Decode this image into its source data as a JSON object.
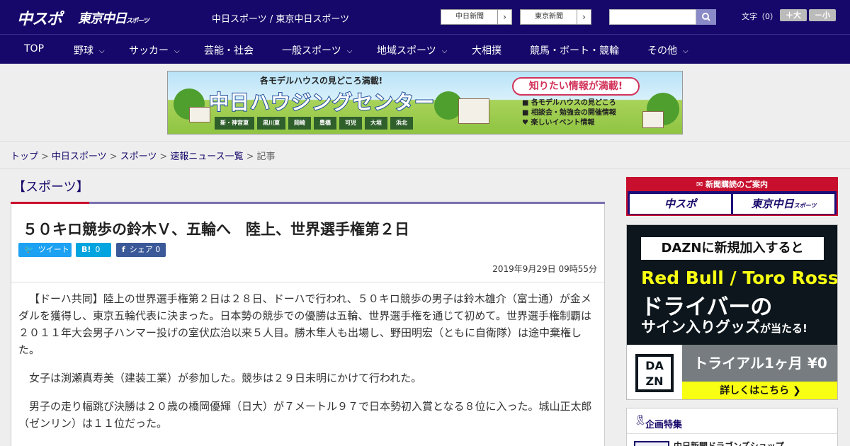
{
  "header": {
    "logo_main": "中スポ",
    "logo_tokyo": "東京中日",
    "logo_tokyo_sub": "スポーツ",
    "site_title": "中日スポーツ / 東京中日スポーツ",
    "links": [
      {
        "label": "中日新聞",
        "arrow": "›"
      },
      {
        "label": "東京新聞",
        "arrow": "›"
      }
    ],
    "search": {
      "placeholder": "",
      "icon": "search-icon"
    },
    "font_size": {
      "label": "文字（0）",
      "increase": "＋大",
      "decrease": "－小"
    }
  },
  "nav": {
    "items": [
      {
        "label": "TOP",
        "has_dropdown": false
      },
      {
        "label": "野球",
        "has_dropdown": true
      },
      {
        "label": "サッカー",
        "has_dropdown": true
      },
      {
        "label": "芸能・社会",
        "has_dropdown": false
      },
      {
        "label": "一般スポーツ",
        "has_dropdown": true
      },
      {
        "label": "地域スポーツ",
        "has_dropdown": true
      },
      {
        "label": "大相撲",
        "has_dropdown": false
      },
      {
        "label": "競馬・ボート・競輪",
        "has_dropdown": false
      },
      {
        "label": "その他",
        "has_dropdown": true
      }
    ],
    "chevron": "⌵"
  },
  "banner": {
    "top_text": "各モデルハウスの見どころ満載!",
    "main_text": "中日ハウジングセンター",
    "bubble": "知りたい情報が満載!",
    "list": [
      "各モデルハウスの見どころ",
      "相談会・勉強会の開催情報",
      "楽しいイベント情報"
    ],
    "locations": [
      "新・神宮東",
      "黒川東",
      "岡崎",
      "豊橋",
      "可児",
      "大垣",
      "浜北"
    ]
  },
  "breadcrumb": {
    "items": [
      {
        "label": "トップ",
        "link": true
      },
      {
        "label": "中日スポーツ",
        "link": true
      },
      {
        "label": "スポーツ",
        "link": true
      },
      {
        "label": "速報ニュース一覧",
        "link": true
      },
      {
        "label": "記事",
        "link": false
      }
    ],
    "separator": ">"
  },
  "section": {
    "title": "【スポーツ】"
  },
  "article": {
    "title": "５０キロ競歩の鈴木Ｖ、五輪へ　陸上、世界選手権第２日",
    "share": [
      {
        "icon": "twitter-icon",
        "label": "ツイート",
        "count": "",
        "color": "#1da1f2"
      },
      {
        "icon": "hatena-icon",
        "label": "B!",
        "count": "0",
        "color": "#00a4de"
      },
      {
        "icon": "facebook-icon",
        "label": "シェア",
        "count": "0",
        "color": "#3b5998"
      }
    ],
    "date": "2019年9月29日 09時55分",
    "paragraphs": [
      "【ドーハ共同】陸上の世界選手権第２日は２８日、ドーハで行われ、５０キロ競歩の男子は鈴木雄介（富士通）が金メダルを獲得し、東京五輪代表に決まった。日本勢の競歩での優勝は五輪、世界選手権を通じて初めて。世界選手権制覇は２０１１年大会男子ハンマー投げの室伏広治以来５人目。勝木隼人も出場し、野田明宏（ともに自衛隊）は途中棄権した。",
      "女子は渕瀬真寿美（建装工業）が参加した。競歩は２９日未明にかけて行われた。",
      "男子の走り幅跳び決勝は２０歳の橋岡優輝（日大）が７メートル９７で日本勢初入賞となる８位に入った。城山正太郎（ゼンリン）は１１位だった。"
    ]
  },
  "sidebar": {
    "subscribe": {
      "head": "新聞購読のご案内",
      "logo1": "中スポ",
      "logo2": "東京中日",
      "logo2_sub": "スポーツ"
    },
    "dazn": {
      "top": "DAZNに新規加入すると",
      "red": "Red Bull / Toro Rosso",
      "driver": "ドライバーの",
      "sign": "サイン入りグッズ",
      "sign_suffix": "が当たる!",
      "logo_line1": "DA",
      "logo_line2": "ZN",
      "trial": "トライアル1ヶ月 ¥0",
      "cta": "詳しくはこちら ❯"
    },
    "feature": {
      "title": "企画特集",
      "item": "中日新聞ドラゴンズショップ"
    }
  },
  "colors": {
    "brand_navy": "#16086a",
    "accent_red": "#c8102e",
    "dazn_yellow": "#f8ff13"
  }
}
